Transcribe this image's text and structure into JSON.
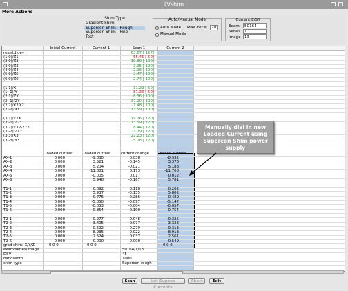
{
  "window": {
    "title": "LVshim"
  },
  "menu": {
    "more_actions": "More Actions"
  },
  "shim_type": {
    "label": "Shim Type",
    "options": [
      "Gradient Shim",
      "Supercon Shim - Rough",
      "Supercon Shim - Fine",
      "Test"
    ],
    "selected": "Supercon Shim - Rough"
  },
  "mode": {
    "label": "Auto/Manual Mode",
    "auto_label": "Auto Mode",
    "manual_label": "Manual Mode",
    "selected": "Manual Mode",
    "max_iters_label": "Max Iter's:",
    "max_iters_value": "20"
  },
  "current_esi": {
    "label": "Current E/S/I",
    "exam_label": "Exam",
    "exam_value": "50164",
    "series_label": "Series",
    "series_value": "1",
    "image_label": "Image",
    "image_value": "13"
  },
  "table": {
    "headers": [
      "Initial Current",
      "Current 1",
      "Scan 1",
      "Current 2"
    ],
    "shim_rows": [
      {
        "label": "res/std dev",
        "scan": "63.67 [ 127]",
        "color": "green"
      },
      {
        "label": "(1  0)/Z1",
        "scan": "-55.45 [  50]",
        "color": "red"
      },
      {
        "label": "(2  0)/Z2",
        "scan": "-19.30 [ 100]",
        "color": "green"
      },
      {
        "label": "(3  0)/Z3",
        "scan": "-3.95 [ 100]",
        "color": "green"
      },
      {
        "label": "(4  0)/Z4",
        "scan": "-2.96 [ 100]",
        "color": "green"
      },
      {
        "label": "(5  0)/Z5",
        "scan": "-2.47 [ 100]",
        "color": "green"
      },
      {
        "label": "(6  0)/Z6",
        "scan": "-2.74 [ 100]",
        "color": "green"
      },
      {
        "label": "",
        "scan": "",
        "color": "green"
      },
      {
        "label": "(1  1)/X",
        "scan": "11.22 [  50]",
        "color": "green"
      },
      {
        "label": "(1 -1)/Y",
        "scan": "81.36 [  50]",
        "color": "red"
      },
      {
        "label": "(2  1)/ZX",
        "scan": "-8.36 [ 100]",
        "color": "green"
      },
      {
        "label": "(2 -1)/ZY",
        "scan": "37.20 [ 100]",
        "color": "green"
      },
      {
        "label": "(2  2)/X2-Y2",
        "scan": "-1.48 [ 100]",
        "color": "green"
      },
      {
        "label": "(2 -2)/XY",
        "scan": "13.59 [ 100]",
        "color": "green"
      },
      {
        "label": "",
        "scan": "",
        "color": "green"
      },
      {
        "label": "(3  1)/Z2X",
        "scan": "19.76 [ 120]",
        "color": "green"
      },
      {
        "label": "(3 -1)/Z2Y",
        "scan": "13.59 [ 120]",
        "color": "green"
      },
      {
        "label": "(3  2)/ZX2-ZY2",
        "scan": "8.44 [ 120]",
        "color": "green"
      },
      {
        "label": "(3 -2)/ZXY",
        "scan": "-1.79 [ 120]",
        "color": "green"
      },
      {
        "label": "(3  3)/X3",
        "scan": "22.23 [ 120]",
        "color": "green"
      },
      {
        "label": "(3 -3)/Y3",
        "scan": "-5.78 [ 120]",
        "color": "green"
      }
    ],
    "loaded_header": {
      "col0": "loaded current",
      "col1": "loaded current",
      "col2": "current change",
      "col3": "loaded current"
    },
    "ax_rows": [
      {
        "label": "AX-1",
        "c0": "0.000",
        "c1": "-9.030",
        "c2": "0.038",
        "c3": "-8.992"
      },
      {
        "label": "AX-2",
        "c0": "0.000",
        "c1": "3.521",
        "c2": "-0.145",
        "c3": "3.376"
      },
      {
        "label": "AX-3",
        "c0": "0.000",
        "c1": "5.204",
        "c2": "-0.021",
        "c3": "5.183"
      },
      {
        "label": "AX-4",
        "c0": "0.000",
        "c1": "-11.881",
        "c2": "0.173",
        "c3": "-11.708"
      },
      {
        "label": "AX-5",
        "c0": "0.000",
        "c1": "-0.005",
        "c2": "0.017",
        "c3": "0.012"
      },
      {
        "label": "AX-6",
        "c0": "0.000",
        "c1": "5.948",
        "c2": "-0.167",
        "c3": "5.781"
      }
    ],
    "t1_rows": [
      {
        "label": "T1-1",
        "c0": "0.000",
        "c1": "0.092",
        "c2": "0.110",
        "c3": "0.202"
      },
      {
        "label": "T1-2",
        "c0": "0.000",
        "c1": "5.937",
        "c2": "-0.135",
        "c3": "5.802"
      },
      {
        "label": "T1-3",
        "c0": "0.000",
        "c1": "0.775",
        "c2": "-0.286",
        "c3": "0.489"
      },
      {
        "label": "T1-4",
        "c0": "0.000",
        "c1": "-5.050",
        "c2": "-0.097",
        "c3": "-5.147"
      },
      {
        "label": "T1-5",
        "c0": "0.000",
        "c1": "-0.053",
        "c2": "-0.004",
        "c3": "-0.057"
      },
      {
        "label": "T1-6",
        "c0": "0.000",
        "c1": "-0.854",
        "c2": "0.100",
        "c3": "-0.754"
      }
    ],
    "t2_rows": [
      {
        "label": "T2-1",
        "c0": "0.000",
        "c1": "-0.277",
        "c2": "-0.048",
        "c3": "-0.325"
      },
      {
        "label": "T2-2",
        "c0": "0.000",
        "c1": "-3.405",
        "c2": "0.077",
        "c3": "-3.328"
      },
      {
        "label": "T2-3",
        "c0": "0.000",
        "c1": "-0.592",
        "c2": "-0.279",
        "c3": "-0.313"
      },
      {
        "label": "T2-4",
        "c0": "0.000",
        "c1": "8.935",
        "c2": "-0.022",
        "c3": "8.913"
      },
      {
        "label": "T2-5",
        "c0": "0.000",
        "c1": "2.524",
        "c2": "0.037",
        "c3": "2.561"
      },
      {
        "label": "T2-6",
        "c0": "0.000",
        "c1": "0.000",
        "c2": "0.000",
        "c3": "0.549"
      }
    ],
    "grad_row": {
      "label": "grad shim: X/Y/Z",
      "c0": "0   0   0",
      "c1": "0   0   0",
      "c2": "------",
      "c3": "0   0   0"
    },
    "info_rows": [
      {
        "label": "exam/series/image",
        "value": "50164/1/13"
      },
      {
        "label": "DSV",
        "value": "45"
      },
      {
        "label": "bandwidth",
        "value": "1000"
      },
      {
        "label": "shim type",
        "value": "Supercon rough"
      }
    ]
  },
  "callout": {
    "text": "Manually dial in new Loaded Current using Supercon Shim power supply"
  },
  "buttons": {
    "scan": "Scan",
    "init": "Init Supcon Currents",
    "abort": "Abort",
    "exit": "Exit"
  },
  "colors": {
    "green": "#2b9a36",
    "red": "#cc1c1c",
    "column_highlight": "#b9cfe8",
    "callout_bg": "#a3a3a3"
  }
}
